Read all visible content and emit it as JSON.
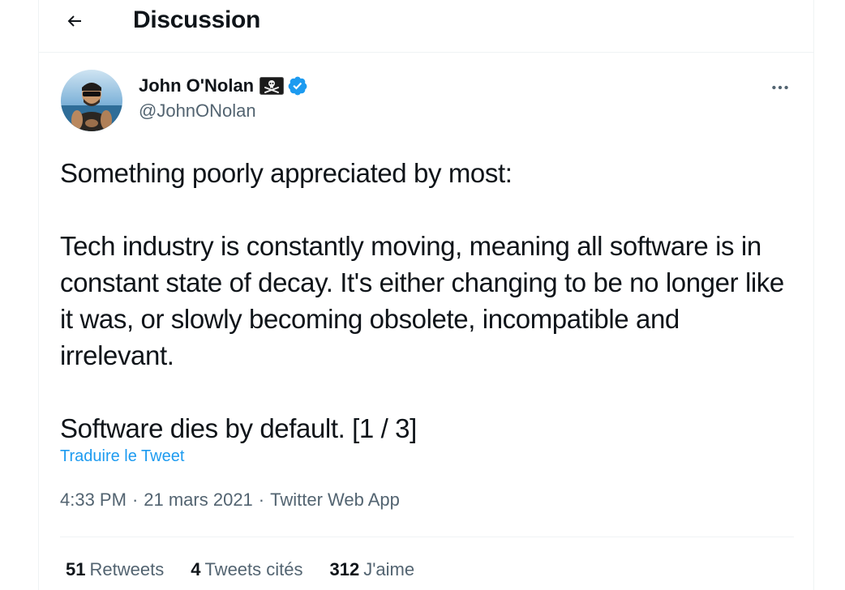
{
  "header": {
    "title": "Discussion",
    "back_icon": "arrow-left-icon"
  },
  "author": {
    "display_name": "John O'Nolan",
    "handle": "@JohnONolan",
    "flag_icon": "pirate-flag-icon",
    "verified_icon": "verified-badge-icon",
    "verified_color": "#1d9bf0"
  },
  "tweet": {
    "text": "Something poorly appreciated by most:\n\nTech industry is constantly moving, meaning all software is in constant state of decay. It's either changing to be no longer like it was, or slowly becoming obsolete, incompatible and irrelevant.\n\nSoftware dies by default. [1 / 3]",
    "translate_label": "Traduire le Tweet",
    "more_icon": "more-options-icon"
  },
  "meta": {
    "time": "4:33 PM",
    "date": "21 mars 2021",
    "source": "Twitter Web App",
    "separator": "·"
  },
  "stats": {
    "retweets": {
      "count": "51",
      "label": "Retweets"
    },
    "quotes": {
      "count": "4",
      "label": "Tweets cités"
    },
    "likes": {
      "count": "312",
      "label": "J'aime"
    }
  },
  "colors": {
    "accent": "#1d9bf0",
    "text": "#0f1419",
    "secondary": "#536471",
    "border": "#eff3f4"
  }
}
